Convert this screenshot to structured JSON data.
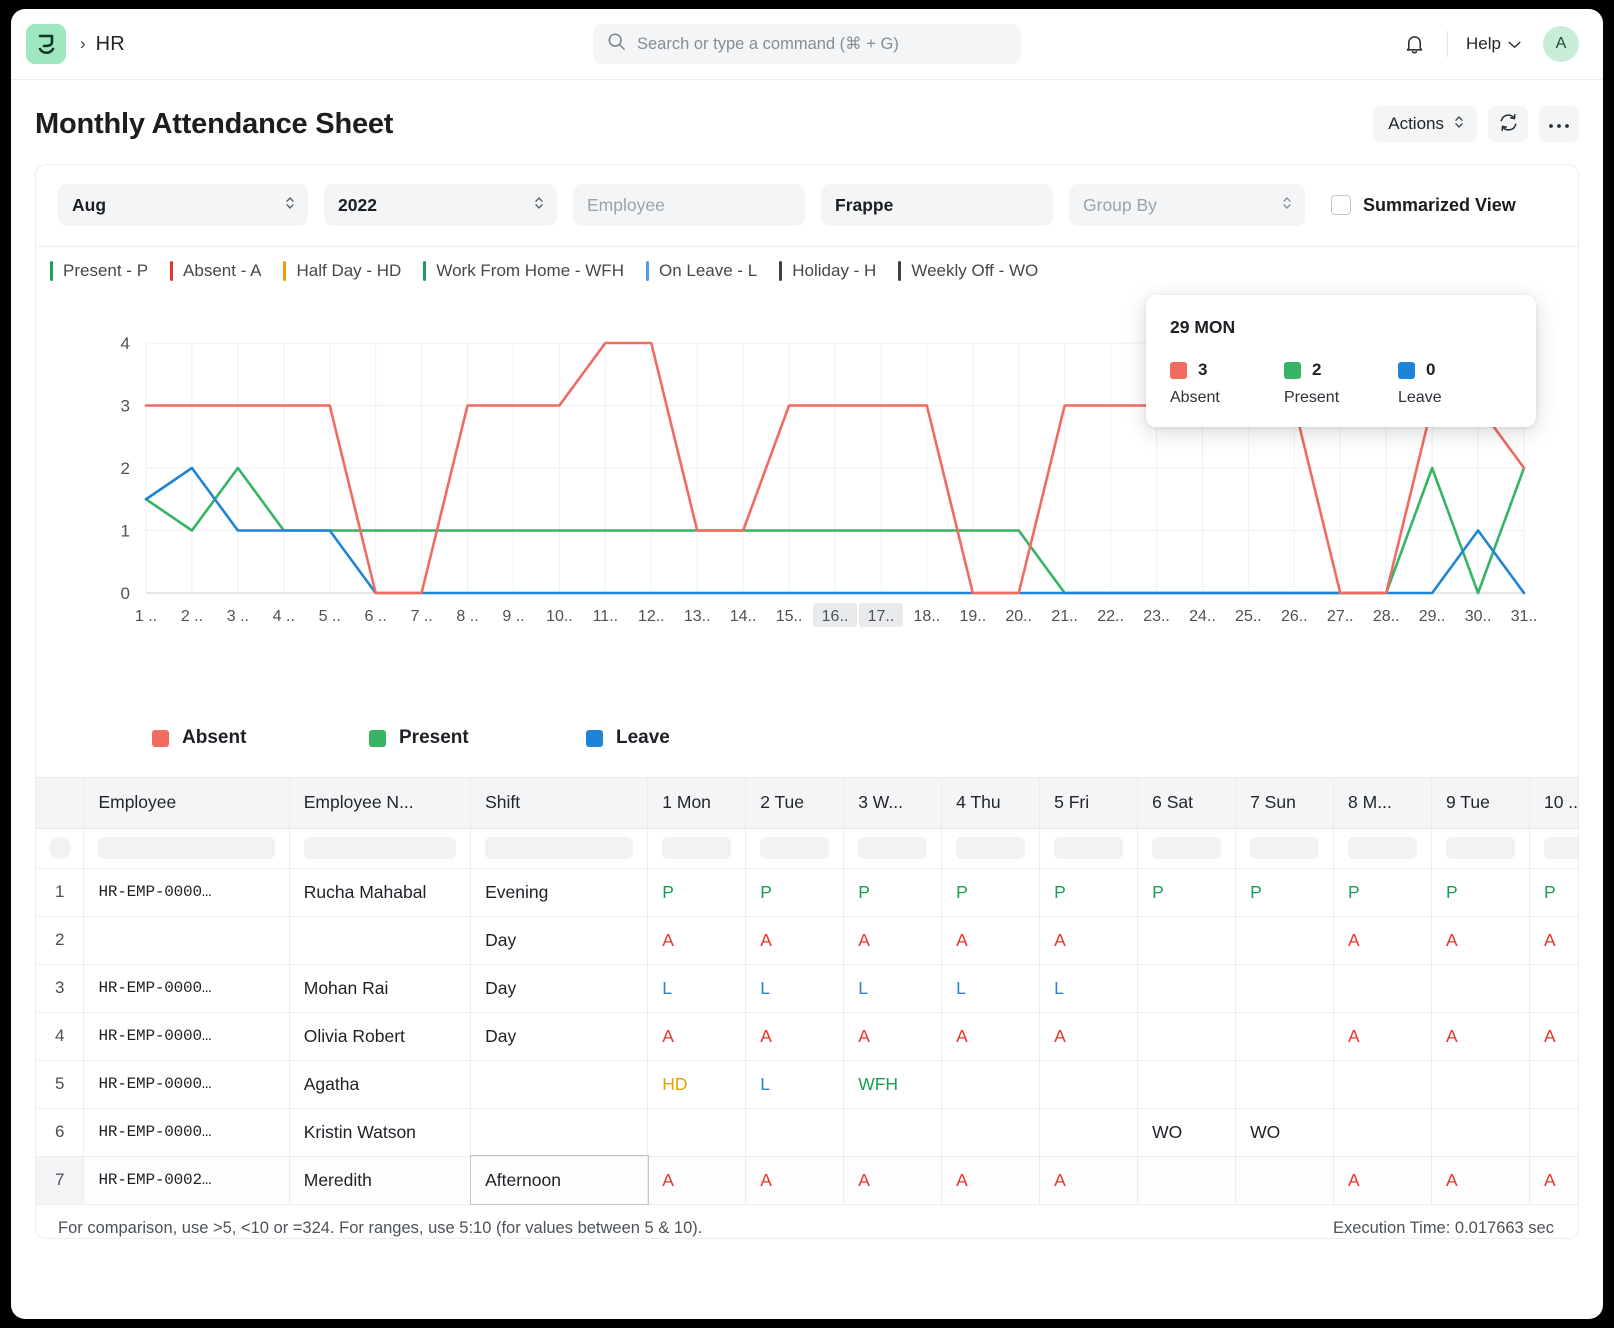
{
  "navbar": {
    "logo_icon": "frappe-logo-icon",
    "breadcrumb_sep": "›",
    "breadcrumb": "HR",
    "search_placeholder": "Search or type a command (⌘ + G)",
    "search_value": "",
    "search_icon": "search-icon",
    "bell_icon": "bell-icon",
    "help_label": "Help",
    "help_chevron_icon": "chevron-down-icon",
    "avatar_initial": "A"
  },
  "page": {
    "title": "Monthly Attendance Sheet",
    "actions_label": "Actions",
    "actions_chevron_icon": "chevron-updown-icon",
    "refresh_icon": "refresh-icon",
    "more_icon": "ellipsis-icon"
  },
  "filters": {
    "month": "Aug",
    "year": "2022",
    "employee_placeholder": "Employee",
    "employee_value": "",
    "company": "Frappe",
    "group_by_placeholder": "Group By",
    "group_by_value": "",
    "summarized_view_label": "Summarized View",
    "summarized_view_checked": false
  },
  "statuses": [
    {
      "label": "Present - P",
      "color": "#1aa053"
    },
    {
      "label": "Absent - A",
      "color": "#e8352b"
    },
    {
      "label": "Half Day - HD",
      "color": "#e8a100"
    },
    {
      "label": "Work From Home - WFH",
      "color": "#1aa053"
    },
    {
      "label": "On Leave - L",
      "color": "#4c9bef"
    },
    {
      "label": "Holiday - H",
      "color": "#3d4145"
    },
    {
      "label": "Weekly Off - WO",
      "color": "#3d4145"
    }
  ],
  "tooltip": {
    "title": "29 MON",
    "items": [
      {
        "value": "3",
        "label": "Absent",
        "color": "#f06b60"
      },
      {
        "value": "2",
        "label": "Present",
        "color": "#36b464"
      },
      {
        "value": "0",
        "label": "Leave",
        "color": "#2084d6"
      }
    ]
  },
  "chart_data": {
    "type": "line",
    "title": "",
    "xlabel": "",
    "ylabel": "",
    "ylim": [
      0,
      4
    ],
    "yticks": [
      0,
      1,
      2,
      3,
      4
    ],
    "grid": true,
    "legend_position": "bottom",
    "highlighted_xticks": [
      "16..",
      "17.."
    ],
    "x": [
      "1 ..",
      "2 ..",
      "3 ..",
      "4 ..",
      "5 ..",
      "6 ..",
      "7 ..",
      "8 ..",
      "9 ..",
      "10..",
      "11..",
      "12..",
      "13..",
      "14..",
      "15..",
      "16..",
      "17..",
      "18..",
      "19..",
      "20..",
      "21..",
      "22..",
      "23..",
      "24..",
      "25..",
      "26..",
      "27..",
      "28..",
      "29..",
      "30..",
      "31.."
    ],
    "series": [
      {
        "name": "Absent",
        "color": "#f06b60",
        "values": [
          3,
          3,
          3,
          3,
          3,
          0,
          0,
          3,
          3,
          3,
          4,
          4,
          1,
          1,
          3,
          3,
          3,
          3,
          0,
          0,
          3,
          3,
          3,
          3,
          3,
          3,
          0,
          0,
          3,
          3,
          2
        ]
      },
      {
        "name": "Present",
        "color": "#36b464",
        "values": [
          1.5,
          1,
          2,
          1,
          1,
          1,
          1,
          1,
          1,
          1,
          1,
          1,
          1,
          1,
          1,
          1,
          1,
          1,
          1,
          1,
          0,
          0,
          0,
          0,
          0,
          0,
          0,
          0,
          2,
          0,
          2
        ]
      },
      {
        "name": "Leave",
        "color": "#2084d6",
        "values": [
          1.5,
          2,
          1,
          1,
          1,
          0,
          0,
          0,
          0,
          0,
          0,
          0,
          0,
          0,
          0,
          0,
          0,
          0,
          0,
          0,
          0,
          0,
          0,
          0,
          0,
          0,
          0,
          0,
          0,
          1,
          0
        ]
      }
    ]
  },
  "table": {
    "columns": [
      {
        "key": "idx",
        "label": ""
      },
      {
        "key": "employee",
        "label": "Employee"
      },
      {
        "key": "employee_name",
        "label": "Employee N..."
      },
      {
        "key": "shift",
        "label": "Shift"
      },
      {
        "key": "d1",
        "label": "1 Mon"
      },
      {
        "key": "d2",
        "label": "2 Tue"
      },
      {
        "key": "d3",
        "label": "3 W..."
      },
      {
        "key": "d4",
        "label": "4 Thu"
      },
      {
        "key": "d5",
        "label": "5 Fri"
      },
      {
        "key": "d6",
        "label": "6 Sat"
      },
      {
        "key": "d7",
        "label": "7 Sun"
      },
      {
        "key": "d8",
        "label": "8 M..."
      },
      {
        "key": "d9",
        "label": "9 Tue"
      },
      {
        "key": "d10",
        "label": "10 ..."
      }
    ],
    "rows": [
      {
        "idx": "1",
        "employee": "HR-EMP-0000…",
        "employee_name": "Rucha Mahabal",
        "shift": "Evening",
        "days": [
          "P",
          "P",
          "P",
          "P",
          "P",
          "P",
          "P",
          "P",
          "P",
          "P"
        ]
      },
      {
        "idx": "2",
        "employee": "",
        "employee_name": "",
        "shift": "Day",
        "days": [
          "A",
          "A",
          "A",
          "A",
          "A",
          "",
          "",
          "A",
          "A",
          "A"
        ]
      },
      {
        "idx": "3",
        "employee": "HR-EMP-0000…",
        "employee_name": "Mohan Rai",
        "shift": "Day",
        "days": [
          "L",
          "L",
          "L",
          "L",
          "L",
          "",
          "",
          "",
          "",
          ""
        ]
      },
      {
        "idx": "4",
        "employee": "HR-EMP-0000…",
        "employee_name": "Olivia Robert",
        "shift": "Day",
        "days": [
          "A",
          "A",
          "A",
          "A",
          "A",
          "",
          "",
          "A",
          "A",
          "A"
        ]
      },
      {
        "idx": "5",
        "employee": "HR-EMP-0000…",
        "employee_name": "Agatha",
        "shift": "",
        "days": [
          "HD",
          "L",
          "WFH",
          "",
          "",
          "",
          "",
          "",
          "",
          ""
        ]
      },
      {
        "idx": "6",
        "employee": "HR-EMP-0000…",
        "employee_name": "Kristin Watson",
        "shift": "",
        "days": [
          "",
          "",
          "",
          "",
          "",
          "WO",
          "WO",
          "",
          "",
          ""
        ]
      },
      {
        "idx": "7",
        "employee": "HR-EMP-0002…",
        "employee_name": "Meredith",
        "shift": "Afternoon",
        "days": [
          "A",
          "A",
          "A",
          "A",
          "A",
          "",
          "",
          "A",
          "A",
          "A"
        ]
      }
    ]
  },
  "footer": {
    "hint": "For comparison, use >5, <10 or =324. For ranges, use 5:10 (for values between 5 & 10).",
    "execution_time": "Execution Time: 0.017663 sec"
  }
}
